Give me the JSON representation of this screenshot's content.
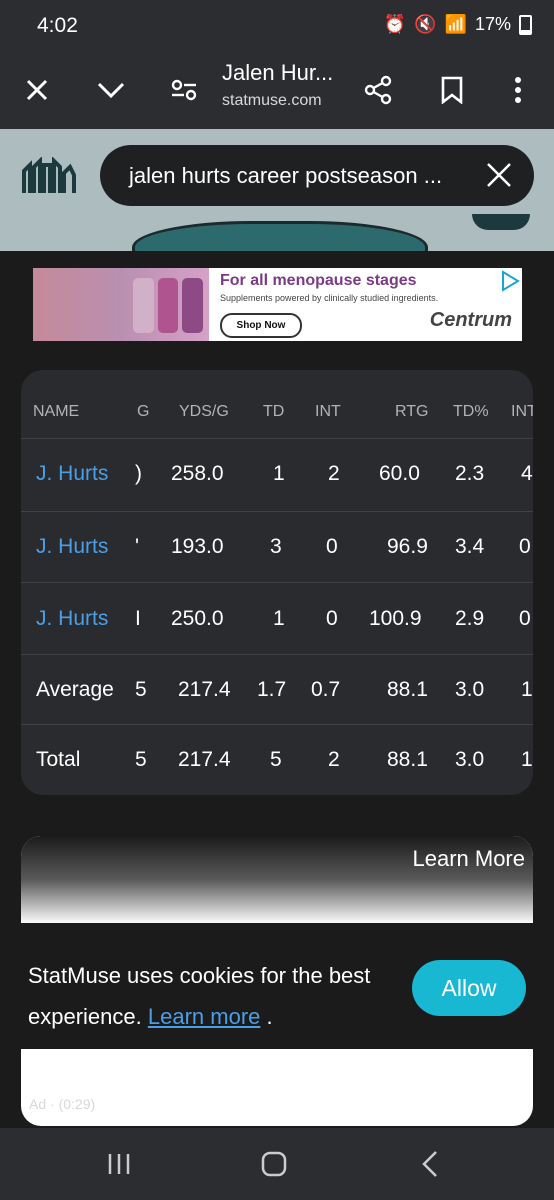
{
  "status": {
    "time": "4:02",
    "battery": "17%"
  },
  "toolbar": {
    "title": "Jalen Hur...",
    "url": "statmuse.com"
  },
  "search": {
    "query": "jalen hurts career postseason ..."
  },
  "ad": {
    "headline": "For all menopause stages",
    "subline": "Supplements powered by clinically studied ingredients.",
    "shop_label": "Shop Now",
    "brand": "Centrum"
  },
  "table": {
    "headers": [
      "NAME",
      "G",
      "YDS/G",
      "TD",
      "INT",
      "RTG",
      "TD%",
      "INT"
    ],
    "rows": [
      {
        "name": "J. Hurts",
        "g": ")",
        "yds": "258.0",
        "td": "1",
        "int": "2",
        "rtg": "60.0",
        "tdp": "2.3",
        "intp": "4"
      },
      {
        "name": "J. Hurts",
        "g": "'",
        "yds": "193.0",
        "td": "3",
        "int": "0",
        "rtg": "96.9",
        "tdp": "3.4",
        "intp": "0"
      },
      {
        "name": "J. Hurts",
        "g": "I",
        "yds": "250.0",
        "td": "1",
        "int": "0",
        "rtg": "100.9",
        "tdp": "2.9",
        "intp": "0"
      },
      {
        "name": "Average",
        "g": "5",
        "yds": "217.4",
        "td": "1.7",
        "int": "0.7",
        "rtg": "88.1",
        "tdp": "3.0",
        "intp": "1"
      },
      {
        "name": "Total",
        "g": "5",
        "yds": "217.4",
        "td": "5",
        "int": "2",
        "rtg": "88.1",
        "tdp": "3.0",
        "intp": "1"
      }
    ]
  },
  "video_ad": {
    "learn_more": "Learn More",
    "timer": "Ad · (0:29)"
  },
  "cookie": {
    "text": "StatMuse uses cookies for the best experience.",
    "link": "Learn more",
    "period": ".",
    "allow": "Allow"
  },
  "colors": {
    "accent": "#18b8d2",
    "link": "#4a9fe6",
    "card": "#2a2b2e"
  },
  "icons": [
    "close-icon",
    "chevron-down-icon",
    "tune-icon",
    "share-icon",
    "bookmark-icon",
    "more-vert-icon",
    "statmuse-logo-icon",
    "search-clear-icon",
    "recents-icon",
    "home-icon",
    "back-icon"
  ]
}
